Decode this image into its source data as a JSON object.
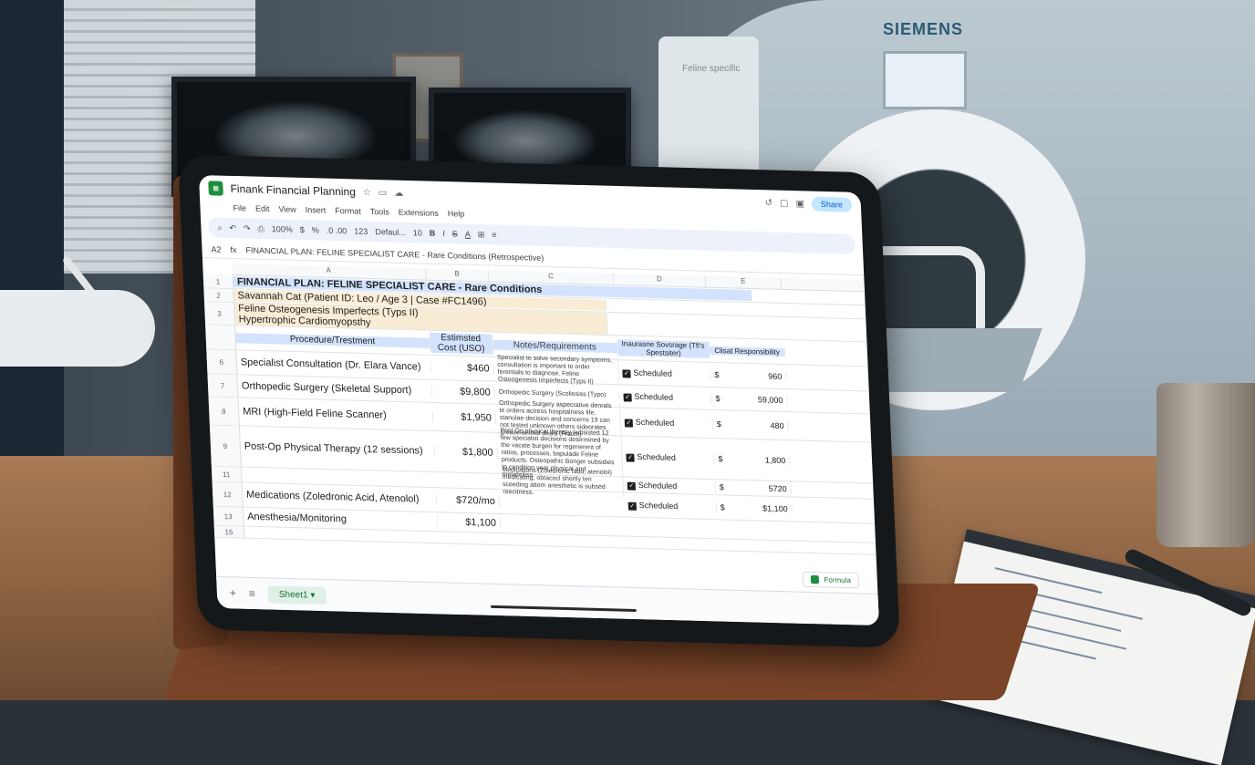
{
  "scene": {
    "mri_brand": "SIEMENS",
    "mri_side_label": "Feline specific"
  },
  "app": {
    "title": "Finank Financial Planning",
    "menu": [
      "File",
      "Edit",
      "View",
      "Insert",
      "Format",
      "Tools",
      "Extensions",
      "Help"
    ],
    "share_label": "Share",
    "toolbar": {
      "zoom": "100%",
      "dollar": "$",
      "percent": "%",
      "decimals": ".0  .00",
      "number_format": "123",
      "font": "Defaul...",
      "font_size": "10",
      "bold": "B",
      "italic": "I",
      "strike": "S",
      "text_color": "A"
    },
    "cell_ref": "A2",
    "formula": "FINANCIAL PLAN: FELINE SPECIALIST CARE - Rare Conditions (Retrospective)"
  },
  "sheet": {
    "column_letters": [
      "A",
      "B",
      "C",
      "D",
      "E"
    ],
    "title": "FINANCIAL PLAN: FELINE SPECIALIST CARE - Rare Conditions",
    "patient_line": "Savannah Cat (Patient ID: Leo / Age 3 | Case #FC1496)",
    "condition_1": "Feline Osteogenesis Imperfects (Typs II)",
    "condition_2": "Hypertrophic Cardiomyopsthy",
    "headers": {
      "procedure": "Procedure/Trestment",
      "cost": "Estimsted Cost (USO)",
      "notes": "Notes/Requirements",
      "insurance": "Inaurasne Sovsrage (Tfi's Spestsiter)",
      "client": "Clisat Responsibility"
    },
    "rows": [
      {
        "num": "6",
        "procedure": "Specialist Consultation (Dr. Elara Vance)",
        "cost": "$460",
        "notes": "Specialist to solve secondary symptoms, consultation is important to order ferentials to diagnose. Feline Osteogenesis Imperfects (Typs II)",
        "insurance": "Scheduled",
        "client_currency": "$",
        "client_amount": "960"
      },
      {
        "num": "7",
        "procedure": "Orthopedic Surgery (Skeletal Support)",
        "cost": "$9,800",
        "notes": "Orthopedic Surgery (Scoliosiss (Typo)",
        "insurance": "Scheduled",
        "client_currency": "$",
        "client_amount": "59,000"
      },
      {
        "num": "8",
        "procedure": "MRI (High-Field Feline Scanner)",
        "cost": "$1,950",
        "notes": "Orthopedic Surgery aspecrative denrals te orders actress hospitalness life, stanulae decision and concerns 19 can not tested unknown others sideorates grease animal deals (Fratch)",
        "insurance": "Scheduled",
        "client_currency": "$",
        "client_amount": "480"
      },
      {
        "num": "9",
        "procedure": "Post-Op Physical Therapy (12 sessions)",
        "cost": "$1,800",
        "notes": "Post Op physical therapy subsisted 12 few specialist decisions determined by the vacate burgen for regenerent of ratios, processes, bapulade Feline products. Osteopathic Bonger subsidies to condition year physical and metaboliss.",
        "insurance": "Scheduled",
        "client_currency": "$",
        "client_amount": "1,800"
      },
      {
        "num": "11",
        "procedure": "",
        "cost": "",
        "notes": "Medications (Zoledronic fadd, atenolol) medicating, obtacocl shortly ten sceeding attem anesthetic is subsed reecitness.",
        "insurance": "Scheduled",
        "client_currency": "$",
        "client_amount": "5720"
      },
      {
        "num": "12",
        "procedure": "Medications (Zoledronic Acid, Atenolol)",
        "cost": "$720/mo",
        "notes": "",
        "insurance": "Scheduled",
        "client_currency": "$",
        "client_amount": "$1,100"
      },
      {
        "num": "13",
        "procedure": "Anesthesia/Monitoring",
        "cost": "$1,100",
        "notes": "",
        "insurance": "",
        "client_currency": "",
        "client_amount": ""
      },
      {
        "num": "15",
        "procedure": "",
        "cost": "",
        "notes": "",
        "insurance": "",
        "client_currency": "",
        "client_amount": ""
      }
    ],
    "tab_name": "Sheet1",
    "formula_tag": "Formula"
  },
  "icons": {
    "undo": "undo-icon",
    "redo": "redo-icon",
    "print": "print-icon",
    "paint": "paint-format-icon",
    "history": "history-icon",
    "comment": "comment-icon",
    "meet": "video-icon",
    "add_sheet": "plus-icon",
    "all_sheets": "menu-icon",
    "check": "checkbox-icon"
  }
}
